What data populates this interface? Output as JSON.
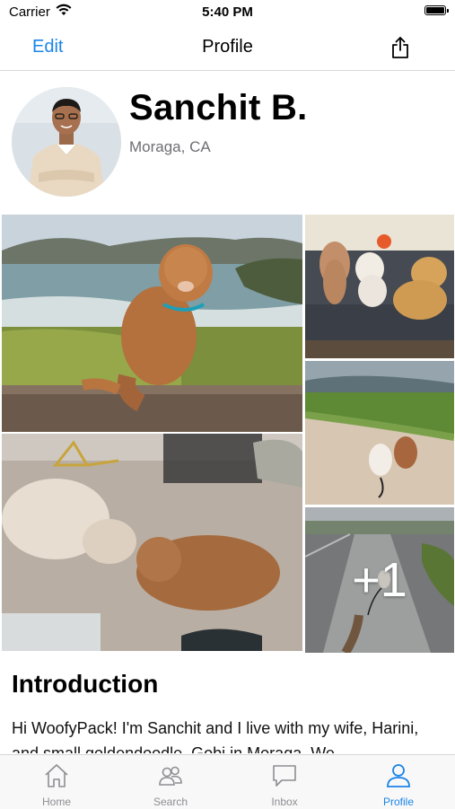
{
  "status_bar": {
    "carrier": "Carrier",
    "time": "5:40 PM"
  },
  "nav": {
    "edit_label": "Edit",
    "title": "Profile",
    "share_icon": "share-icon"
  },
  "profile": {
    "name": "Sanchit B.",
    "location": "Moraga, CA"
  },
  "photos": {
    "more_count": "+1"
  },
  "intro": {
    "heading": "Introduction",
    "text": "Hi WoofyPack! I'm Sanchit and I live with my wife, Harini, and small goldendoodle, Gobi in Moraga. We"
  },
  "tabs": [
    {
      "label": "Home",
      "icon": "home-icon"
    },
    {
      "label": "Search",
      "icon": "people-icon"
    },
    {
      "label": "Inbox",
      "icon": "chat-bubble-icon"
    },
    {
      "label": "Profile",
      "icon": "person-icon"
    }
  ],
  "colors": {
    "accent": "#1a84e8",
    "tab_inactive": "#8e8e93",
    "secondary_text": "#6e6e73"
  }
}
